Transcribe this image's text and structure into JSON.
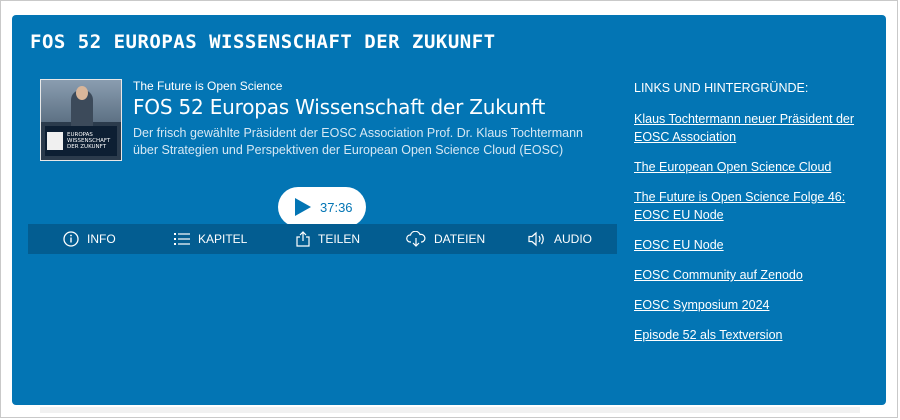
{
  "heading": "FOS 52 EUROPAS WISSENSCHAFT DER ZUKUNFT",
  "player": {
    "cover_text": "Europas Wissenschaft der Zukunft",
    "podcast_name": "The Future is Open Science",
    "episode_title": "FOS 52 Europas Wissenschaft der Zukunft",
    "description": "Der frisch gewählte Präsident der EOSC Association Prof. Dr. Klaus Tochtermann über Strategien und Perspektiven der European Open Science Cloud (EOSC)",
    "duration": "37:36",
    "tabs": [
      {
        "label": "INFO",
        "icon": "info-icon"
      },
      {
        "label": "KAPITEL",
        "icon": "list-icon"
      },
      {
        "label": "TEILEN",
        "icon": "share-icon"
      },
      {
        "label": "DATEIEN",
        "icon": "cloud-download-icon"
      },
      {
        "label": "AUDIO",
        "icon": "speaker-icon"
      }
    ]
  },
  "links": {
    "heading": "LINKS UND HINTERGRÜNDE:",
    "items": [
      "Klaus Tochtermann neuer Präsident der EOSC Association",
      "The European Open Science Cloud",
      "The Future is Open Science Folge 46: EOSC EU Node",
      "EOSC EU Node",
      "EOSC Community auf Zenodo",
      "EOSC Symposium 2024",
      "Episode 52 als Textversion"
    ]
  },
  "colors": {
    "card_bg": "#0375b4",
    "tabbar_bg": "#035d91",
    "text": "#ffffff"
  }
}
